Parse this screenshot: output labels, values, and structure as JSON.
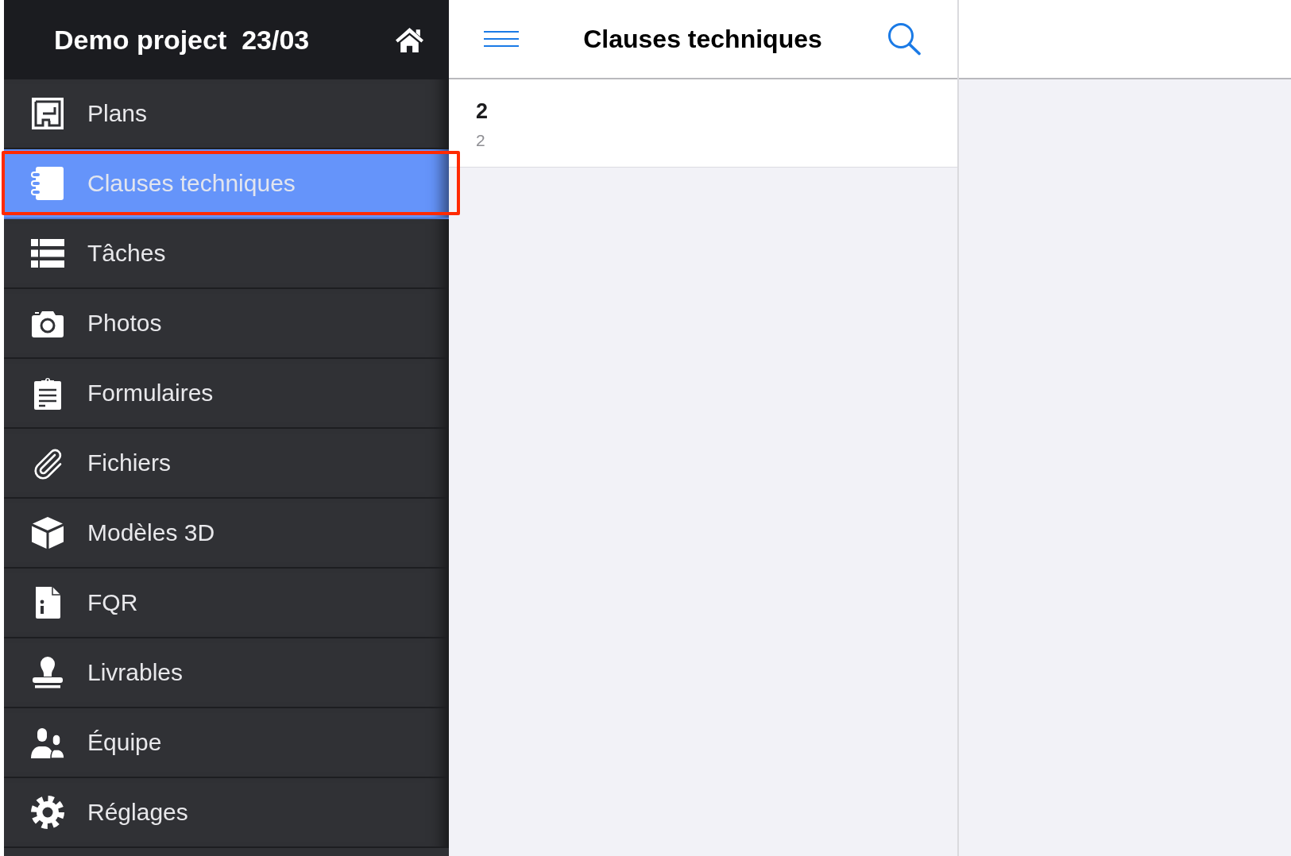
{
  "sidebar": {
    "project_title": "Demo project  23/03",
    "items": [
      {
        "label": "Plans",
        "selected": false,
        "highlighted": false
      },
      {
        "label": "Clauses techniques",
        "selected": true,
        "highlighted": true
      },
      {
        "label": "Tâches",
        "selected": false,
        "highlighted": false
      },
      {
        "label": "Photos",
        "selected": false,
        "highlighted": false
      },
      {
        "label": "Formulaires",
        "selected": false,
        "highlighted": false
      },
      {
        "label": "Fichiers",
        "selected": false,
        "highlighted": false
      },
      {
        "label": "Modèles 3D",
        "selected": false,
        "highlighted": false
      },
      {
        "label": "FQR",
        "selected": false,
        "highlighted": false
      },
      {
        "label": "Livrables",
        "selected": false,
        "highlighted": false
      },
      {
        "label": "Équipe",
        "selected": false,
        "highlighted": false
      },
      {
        "label": "Réglages",
        "selected": false,
        "highlighted": false
      }
    ]
  },
  "list_panel": {
    "title": "Clauses techniques",
    "rows": [
      {
        "title": "2",
        "subtitle": "2"
      }
    ]
  }
}
